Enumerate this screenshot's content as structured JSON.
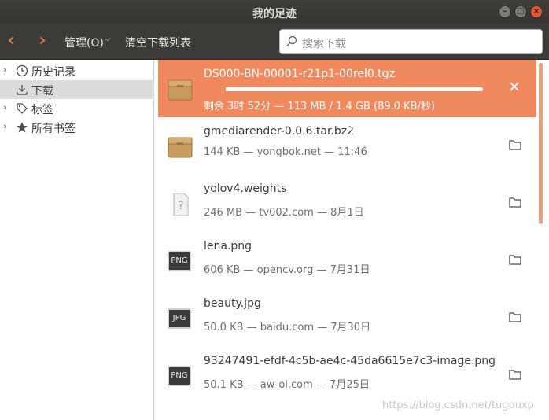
{
  "window": {
    "title": "我的足迹",
    "controls": [
      "–",
      "□",
      "×"
    ]
  },
  "toolbar": {
    "back_glyph": "‹",
    "forward_glyph": "›",
    "manage_label": "管理(O)",
    "manage_chevron": "⌵",
    "clear_label": "清空下载列表"
  },
  "search": {
    "placeholder": "搜索下载",
    "icon": "search-icon"
  },
  "sidebar": {
    "items": [
      {
        "label": "历史记录",
        "icon": "clock-icon",
        "selected": false,
        "arrow": "›"
      },
      {
        "label": "下载",
        "icon": "download-icon",
        "selected": true,
        "arrow": ""
      },
      {
        "label": "标签",
        "icon": "tag-icon",
        "selected": false,
        "arrow": "›"
      },
      {
        "label": "所有书签",
        "icon": "star-icon",
        "selected": false,
        "arrow": "›"
      }
    ]
  },
  "downloads": {
    "items": [
      {
        "name": "DS000-BN-00001-r21p1-00rel0.tgz",
        "meta": "剩余 3时 52分 — 113 MB / 1.4 GB (89.0 KB/秒)",
        "icon": "archive-icon",
        "active": true,
        "progress": 0.08
      },
      {
        "name": "gmediarender-0.0.6.tar.bz2",
        "meta": "144 KB — yongbok.net — 11:46",
        "icon": "archive-icon",
        "active": false
      },
      {
        "name": "yolov4.weights",
        "meta": "246 MB — tv002.com — 8月1日",
        "icon": "unknown-file-icon",
        "active": false
      },
      {
        "name": "lena.png",
        "meta": "606 KB — opencv.org — 7月31日",
        "icon": "png-file-icon",
        "icon_text": "PNG",
        "active": false
      },
      {
        "name": "beauty.jpg",
        "meta": "50.0 KB — baidu.com — 7月30日",
        "icon": "jpg-file-icon",
        "icon_text": "JPG",
        "active": false
      },
      {
        "name": "93247491-efdf-4c5b-ae4c-45da6615e7c3-image.png",
        "meta": "50.1 KB — aw-ol.com — 7月25日",
        "icon": "png-file-icon",
        "icon_text": "PNG",
        "active": false
      }
    ]
  },
  "colors": {
    "accent": "#f08a5e",
    "titlebar": "#3c3b37",
    "close": "#e8582f"
  },
  "footer": {
    "watermark": "https://blog.csdn.net/tugouxp"
  }
}
